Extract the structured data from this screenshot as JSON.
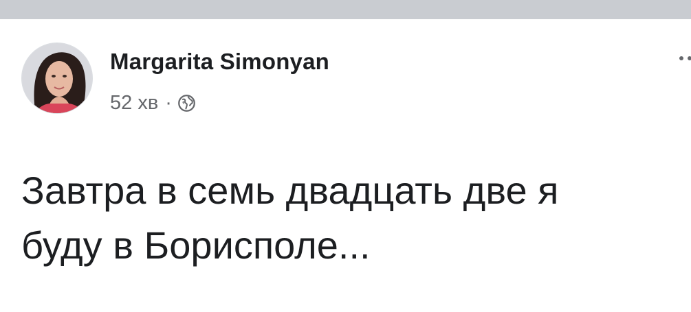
{
  "post": {
    "author": "Margarita Simonyan",
    "time": "52 хв",
    "separator": "·",
    "privacy_icon": "globe-icon",
    "text": "Завтра в семь двадцать две я\nбуду в Борисполе..."
  },
  "colors": {
    "top_bar": "#c9ccd1",
    "author": "#1c1e21",
    "meta": "#65676b",
    "text": "#1c1e21"
  }
}
